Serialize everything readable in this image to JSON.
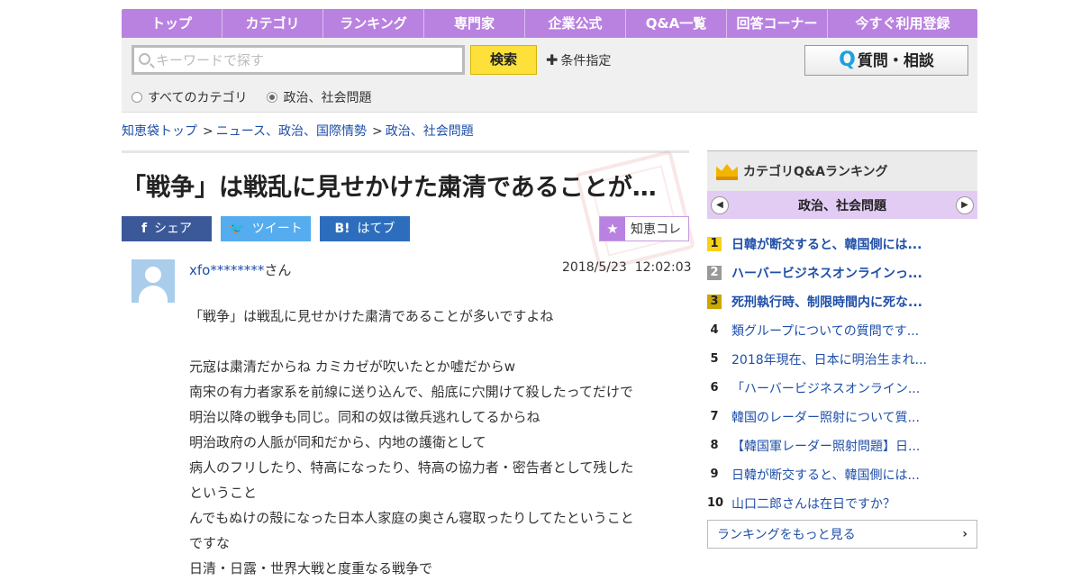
{
  "nav": {
    "items": [
      "トップ",
      "カテゴリ",
      "ランキング",
      "専門家",
      "企業公式",
      "Q&A一覧",
      "回答コーナー",
      "今すぐ利用登録"
    ]
  },
  "search": {
    "placeholder": "キーワードで探す",
    "button": "検索",
    "conditions": "条件指定",
    "ask_button": "質問・相談",
    "scope_all": "すべてのカテゴリ",
    "scope_current": "政治、社会問題"
  },
  "breadcrumb": {
    "items": [
      "知恵袋トップ",
      "ニュース、政治、国際情勢",
      "政治、社会問題"
    ],
    "separator": ">"
  },
  "question": {
    "title": "「戦争」は戦乱に見せかけた粛清であることが…",
    "username": "xfo********",
    "honorific": "さん",
    "date": "2018/5/23",
    "time": "12:02:03",
    "lines": [
      "「戦争」は戦乱に見せかけた粛清であることが多いですよね",
      "",
      "元寇は粛清だからね カミカゼが吹いたとか嘘だからw",
      "南宋の有力者家系を前線に送り込んで、船底に穴開けて殺したってだけで",
      "明治以降の戦争も同じ。同和の奴は徴兵逃れしてるからね",
      "明治政府の人脈が同和だから、内地の護衛として",
      "病人のフリしたり、特高になったり、特高の協力者・密告者として残した",
      "ということ",
      "んでもぬけの殻になった日本人家庭の奥さん寝取ったりしてたということ",
      "ですな",
      "日清・日露・世界大戦と度重なる戦争で"
    ]
  },
  "share": {
    "facebook": "シェア",
    "twitter": "ツイート",
    "hatena": "はてブ",
    "chiekore": "知恵コレ"
  },
  "ranking": {
    "title": "カテゴリQ&Aランキング",
    "category": "政治、社会問題",
    "items": [
      {
        "rank": "1",
        "text": "日韓が断交すると、韓国側には..."
      },
      {
        "rank": "2",
        "text": "ハーバービジネスオンラインっ..."
      },
      {
        "rank": "3",
        "text": "死刑執行時、制限時間内に死な..."
      },
      {
        "rank": "4",
        "text": "類グループについての質問です..."
      },
      {
        "rank": "5",
        "text": "2018年現在、日本に明治生まれ..."
      },
      {
        "rank": "6",
        "text": "「ハーバービジネスオンライン..."
      },
      {
        "rank": "7",
        "text": "韓国のレーダー照射について質..."
      },
      {
        "rank": "8",
        "text": "【韓国軍レーダー照射問題】日..."
      },
      {
        "rank": "9",
        "text": "日韓が断交すると、韓国側には..."
      },
      {
        "rank": "10",
        "text": "山口二郎さんは在日ですか？"
      }
    ],
    "more": "ランキングをもっと見る"
  },
  "colors": {
    "nav_purple": "#b982e0",
    "link_blue": "#1f4fa8",
    "search_yellow": "#fde03a",
    "facebook": "#3b5998",
    "twitter": "#55acee",
    "hatena": "#2c6ebd"
  }
}
